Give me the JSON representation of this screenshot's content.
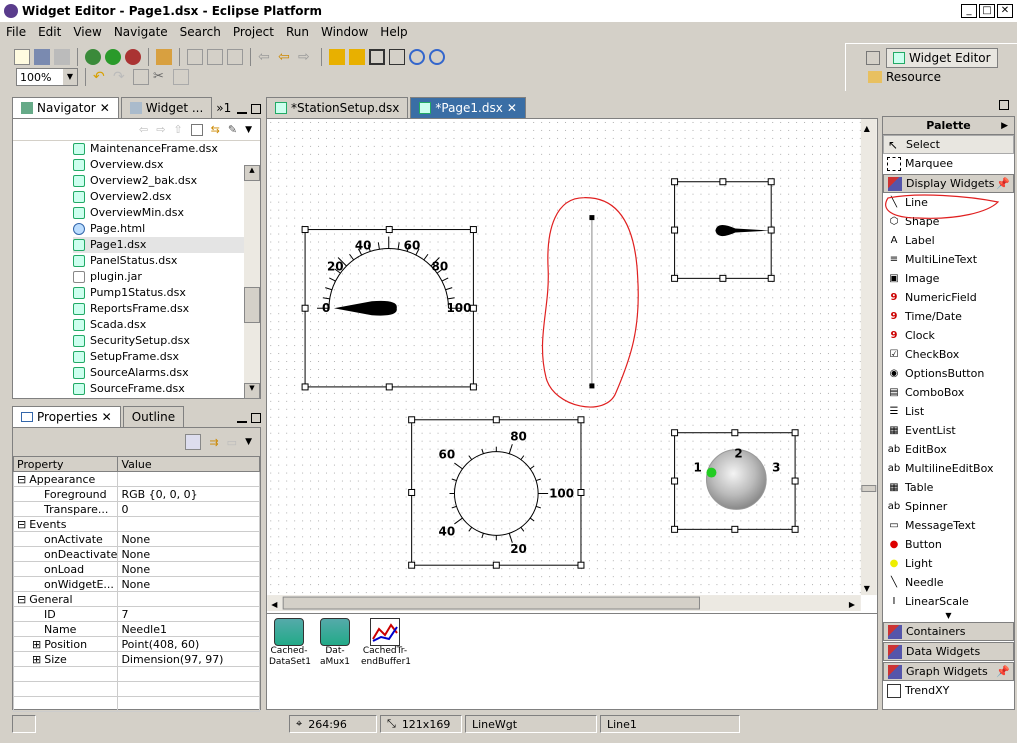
{
  "window": {
    "title": "Widget Editor - Page1.dsx - Eclipse Platform"
  },
  "menu": [
    "File",
    "Edit",
    "View",
    "Navigate",
    "Search",
    "Project",
    "Run",
    "Window",
    "Help"
  ],
  "toolbar": {
    "zoom": "100%"
  },
  "perspective": {
    "widget_editor": "Widget Editor",
    "resource": "Resource"
  },
  "navigator": {
    "tabs": [
      "Navigator",
      "Widget ...",
      "»1"
    ],
    "files": [
      "MaintenanceFrame.dsx",
      "Overview.dsx",
      "Overview2_bak.dsx",
      "Overview2.dsx",
      "OverviewMin.dsx",
      "Page.html",
      "Page1.dsx",
      "PanelStatus.dsx",
      "plugin.jar",
      "Pump1Status.dsx",
      "ReportsFrame.dsx",
      "Scada.dsx",
      "SecuritySetup.dsx",
      "SetupFrame.dsx",
      "SourceAlarms.dsx",
      "SourceFrame.dsx"
    ]
  },
  "properties": {
    "tabs": [
      "Properties",
      "Outline"
    ],
    "headers": {
      "property": "Property",
      "value": "Value"
    },
    "rows": [
      {
        "k": "Appearance",
        "v": "",
        "group": true
      },
      {
        "k": "Foreground",
        "v": "RGB {0, 0, 0}"
      },
      {
        "k": "Transpare...",
        "v": "0"
      },
      {
        "k": "Events",
        "v": "",
        "group": true
      },
      {
        "k": "onActivate",
        "v": "None"
      },
      {
        "k": "onDeactivate",
        "v": "None"
      },
      {
        "k": "onLoad",
        "v": "None"
      },
      {
        "k": "onWidgetE...",
        "v": "None"
      },
      {
        "k": "General",
        "v": "",
        "group": true
      },
      {
        "k": "ID",
        "v": "7"
      },
      {
        "k": "Name",
        "v": "Needle1"
      },
      {
        "k": "Position",
        "v": "Point(408, 60)",
        "expand": true
      },
      {
        "k": "Size",
        "v": "Dimension(97, 97)",
        "expand": true
      }
    ]
  },
  "editor": {
    "tabs": [
      "*StationSetup.dsx",
      "*Page1.dsx"
    ],
    "gauge1": {
      "labels": [
        "0",
        "20",
        "40",
        "60",
        "80",
        "100"
      ]
    },
    "gauge2": {
      "labels": [
        "60",
        "80",
        "100",
        "20",
        "40"
      ]
    },
    "knob": {
      "labels": [
        "1",
        "2",
        "3"
      ]
    }
  },
  "trays": [
    {
      "label": "Cached-\nDataSet1"
    },
    {
      "label": "Dat-\naMux1"
    },
    {
      "label": "CachedTr-\nendBuffer1"
    }
  ],
  "palette": {
    "title": "Palette",
    "tools": [
      "Select",
      "Marquee"
    ],
    "drawer": "Display Widgets",
    "items": [
      "Line",
      "Shape",
      "Label",
      "MultiLineText",
      "Image",
      "NumericField",
      "Time/Date",
      "Clock",
      "CheckBox",
      "OptionsButton",
      "ComboBox",
      "List",
      "EventList",
      "EditBox",
      "MultilineEditBox",
      "Table",
      "Spinner",
      "MessageText",
      "Button",
      "Light",
      "Needle",
      "LinearScale"
    ],
    "drawers": [
      "Containers",
      "Data Widgets",
      "Graph Widgets"
    ],
    "last": "TrendXY"
  },
  "status": {
    "coords": "264:96",
    "size": "121x169",
    "type": "LineWgt",
    "name": "Line1"
  },
  "colors": {
    "annotation": "#e02020",
    "knob_dot": "#22cc22"
  }
}
